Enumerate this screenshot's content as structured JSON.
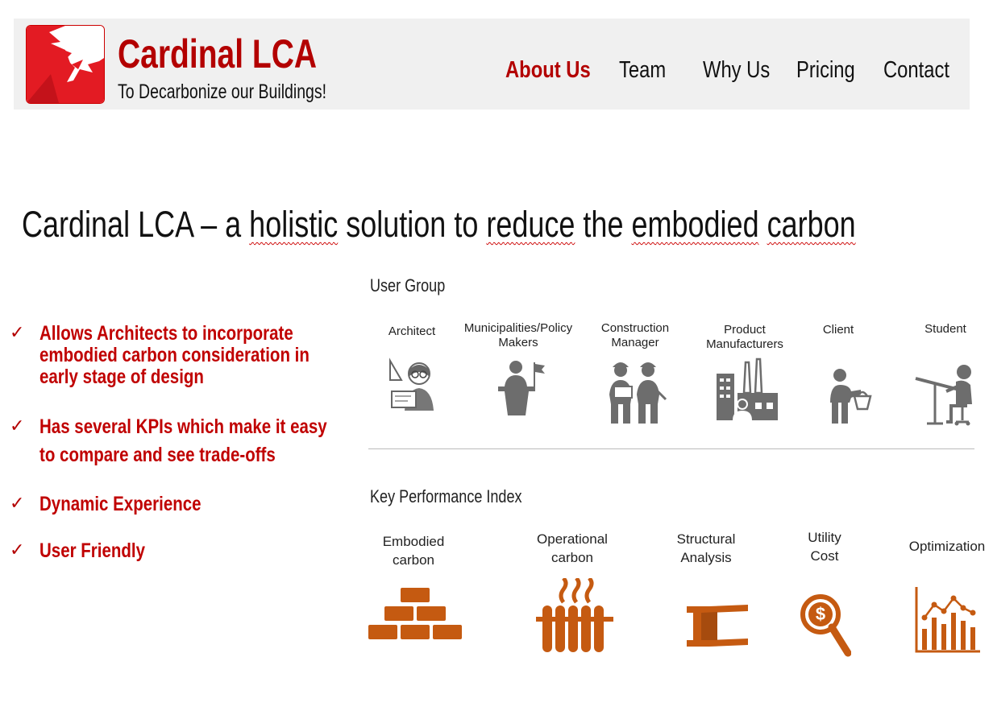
{
  "header": {
    "brand_name": "Cardinal LCA",
    "tagline": "To Decarbonize our Buildings!",
    "nav": [
      {
        "label": "About Us",
        "active": true
      },
      {
        "label": "Team",
        "active": false
      },
      {
        "label": "Why Us",
        "active": false
      },
      {
        "label": "Pricing",
        "active": false
      },
      {
        "label": "Contact",
        "active": false
      }
    ]
  },
  "headline": {
    "part1": "Cardinal LCA – a ",
    "holistic": "holistic",
    "part2": " solution to ",
    "reduce": "reduce",
    "part3": " the ",
    "embodied": "embodied",
    "space": " ",
    "carbon": "carbon"
  },
  "features": {
    "check_glyph": "✓",
    "items": [
      {
        "line1": "Allows Architects to incorporate",
        "line2": "embodied carbon consideration in",
        "line3": "early stage of design"
      },
      {
        "line1": "Has several KPIs which make it easy",
        "line2": "to compare and see trade-offs"
      },
      {
        "line1": "Dynamic Experience"
      },
      {
        "line1": "User Friendly"
      }
    ]
  },
  "user_group": {
    "title": "User Group",
    "items": [
      {
        "line1": "Architect",
        "line2": "",
        "icon": "architect-icon"
      },
      {
        "line1": "Municipalities/Policy",
        "line2": "Makers",
        "icon": "policy-maker-icon"
      },
      {
        "line1": "Construction",
        "line2": "Manager",
        "icon": "construction-manager-icon"
      },
      {
        "line1": "Product",
        "line2": "Manufacturers",
        "icon": "factory-icon"
      },
      {
        "line1": "Client",
        "line2": "",
        "icon": "client-icon"
      },
      {
        "line1": "Student",
        "line2": "",
        "icon": "student-icon"
      }
    ]
  },
  "kpi": {
    "title": "Key Performance Index",
    "items": [
      {
        "line1": "Embodied",
        "line2": "carbon",
        "icon": "bricks-icon"
      },
      {
        "line1": "Operational",
        "line2": "carbon",
        "icon": "radiator-icon"
      },
      {
        "line1": "Structural",
        "line2": "Analysis",
        "icon": "i-beam-icon"
      },
      {
        "line1": "Utility",
        "line2": "Cost",
        "icon": "dollar-search-icon"
      },
      {
        "line1": "Optimization",
        "line2": "",
        "icon": "chart-icon"
      }
    ]
  },
  "colors": {
    "brand_red": "#b30000",
    "icon_gray": "#6d6d6d",
    "icon_orange": "#c55a11",
    "header_bg": "#f0f0f0"
  }
}
